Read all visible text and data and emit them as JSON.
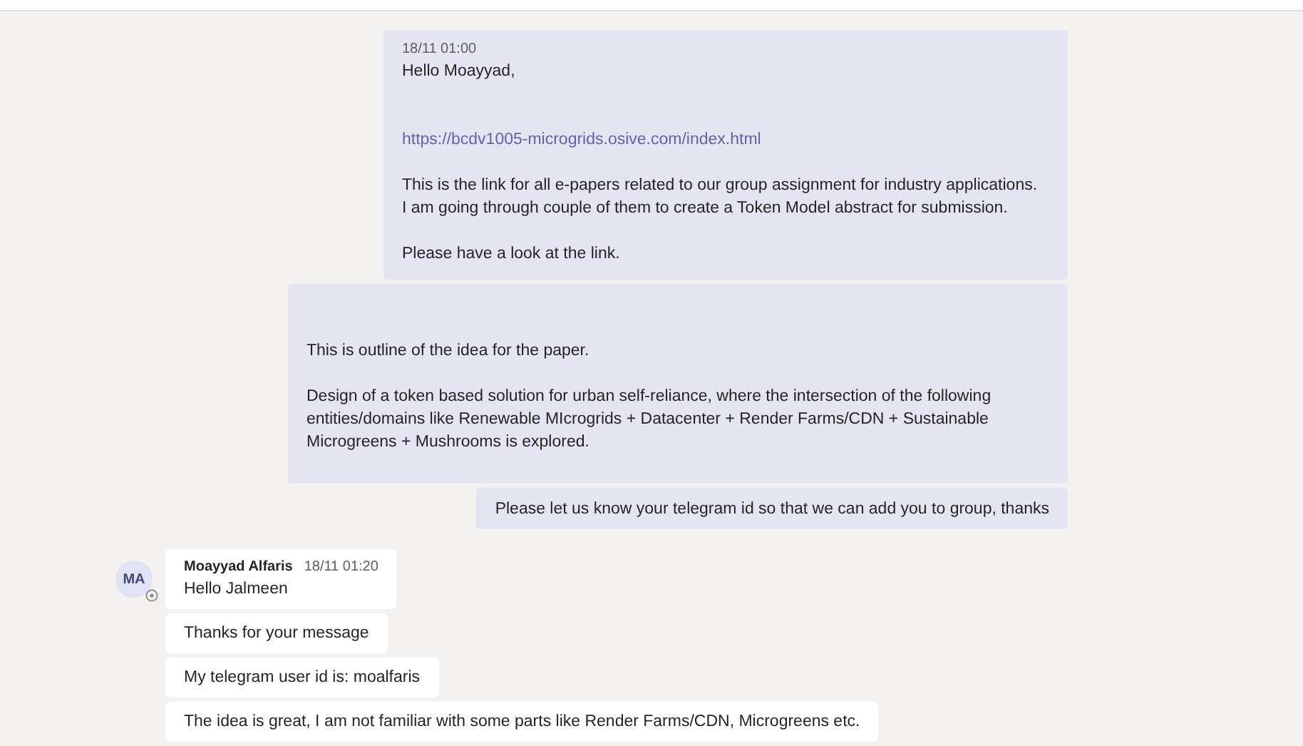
{
  "outgoing": [
    {
      "time": "18/11 01:00",
      "paragraphs": [
        {
          "kind": "text",
          "text": "Hello Moayyad,"
        },
        {
          "kind": "blank"
        },
        {
          "kind": "blank"
        },
        {
          "kind": "link",
          "text": "https://bcdv1005-microgrids.osive.com/index.html"
        },
        {
          "kind": "blank"
        },
        {
          "kind": "text",
          "text": "This is the link for all e-papers related to our group assignment for industry applications.\nI am going through couple of them to create a Token Model abstract for submission."
        },
        {
          "kind": "blank"
        },
        {
          "kind": "text",
          "text": "Please have a look at the link."
        }
      ]
    },
    {
      "paragraphs": [
        {
          "kind": "blank"
        },
        {
          "kind": "blank"
        },
        {
          "kind": "text",
          "text": "This is outline of the idea for the paper."
        },
        {
          "kind": "blank"
        },
        {
          "kind": "text",
          "text": "Design of a token based solution for urban self-reliance, where the intersection of the following\nentities/domains like Renewable MIcrogrids + Datacenter + Render Farms/CDN + Sustainable\nMicrogreens + Mushrooms is explored."
        }
      ]
    },
    {
      "paragraphs": [
        {
          "kind": "text",
          "text": "Please let us know your telegram id so that we can add you to group, thanks"
        }
      ]
    }
  ],
  "incoming": {
    "avatar": "MA",
    "sender": "Moayyad Alfaris",
    "time": "18/11 01:20",
    "messages": [
      {
        "text": "Hello Jalmeen"
      },
      {
        "text": "Thanks for your message"
      },
      {
        "text": "My telegram user id is: moalfaris"
      },
      {
        "text": "The idea is great, I am not familiar with some parts like Render Farms/CDN, Microgreens etc."
      }
    ]
  }
}
